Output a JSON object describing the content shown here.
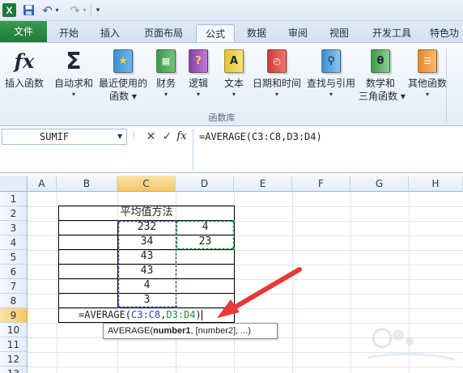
{
  "qat": {
    "icons": [
      "excel-logo-icon",
      "save-icon",
      "undo-icon",
      "redo-icon",
      "customize-qat-icon"
    ],
    "excel_logo_text": "X"
  },
  "tabs": [
    {
      "label": "文件",
      "active": false,
      "file": true
    },
    {
      "label": "开始",
      "active": false
    },
    {
      "label": "插入",
      "active": false
    },
    {
      "label": "页面布局",
      "active": false
    },
    {
      "label": "公式",
      "active": true
    },
    {
      "label": "数据",
      "active": false
    },
    {
      "label": "审阅",
      "active": false
    },
    {
      "label": "视图",
      "active": false
    },
    {
      "label": "开发工具",
      "active": false
    },
    {
      "label": "特色功",
      "active": false
    }
  ],
  "ribbon": {
    "group_label": "函数库",
    "buttons": [
      {
        "line1": "插入函数",
        "line2": "",
        "arrow": false,
        "icon": "fx-icon"
      },
      {
        "line1": "自动求和",
        "line2": "",
        "arrow": true,
        "icon": "sigma-icon"
      },
      {
        "line1": "最近使用的",
        "line2": "函数",
        "arrow": true,
        "icon": "recent-functions-icon"
      },
      {
        "line1": "财务",
        "line2": "",
        "arrow": true,
        "icon": "financial-icon"
      },
      {
        "line1": "逻辑",
        "line2": "",
        "arrow": true,
        "icon": "logical-icon"
      },
      {
        "line1": "文本",
        "line2": "",
        "arrow": true,
        "icon": "text-icon"
      },
      {
        "line1": "日期和时间",
        "line2": "",
        "arrow": true,
        "icon": "date-time-icon"
      },
      {
        "line1": "查找与引用",
        "line2": "",
        "arrow": true,
        "icon": "lookup-reference-icon"
      },
      {
        "line1": "数学和",
        "line2": "三角函数",
        "arrow": true,
        "icon": "math-trig-icon"
      },
      {
        "line1": "其他函数",
        "line2": "",
        "arrow": true,
        "icon": "more-functions-icon"
      }
    ]
  },
  "formula_bar": {
    "name_box": "SUMIF",
    "cancel_glyph": "✕",
    "enter_glyph": "✓",
    "fx_label": "fx",
    "formula": "=AVERAGE(C3:C8,D3:D4)"
  },
  "grid": {
    "columns": [
      "A",
      "B",
      "C",
      "D",
      "E",
      "F",
      "G",
      "H"
    ],
    "rows": [
      "1",
      "2",
      "3",
      "4",
      "5",
      "6",
      "7",
      "8",
      "9",
      "10",
      "11",
      "12",
      "13"
    ],
    "title": "平均值方法",
    "c_values": [
      "232",
      "34",
      "43",
      "43",
      "4",
      "3"
    ],
    "d_values": [
      "4",
      "23"
    ],
    "edit_cell": {
      "prefix": "=AVERAGE(",
      "ref1": "C3:C8",
      "comma": ",",
      "ref2": "D3:D4",
      "suffix": ")"
    },
    "colors": {
      "ref1": "#2f3fbf",
      "ref2": "#1f8a3a",
      "arrow": "#e8393a"
    }
  },
  "tooltip": {
    "prefix": "AVERAGE(",
    "arg_bold": "number1",
    "rest": ", [number2], ...)"
  }
}
